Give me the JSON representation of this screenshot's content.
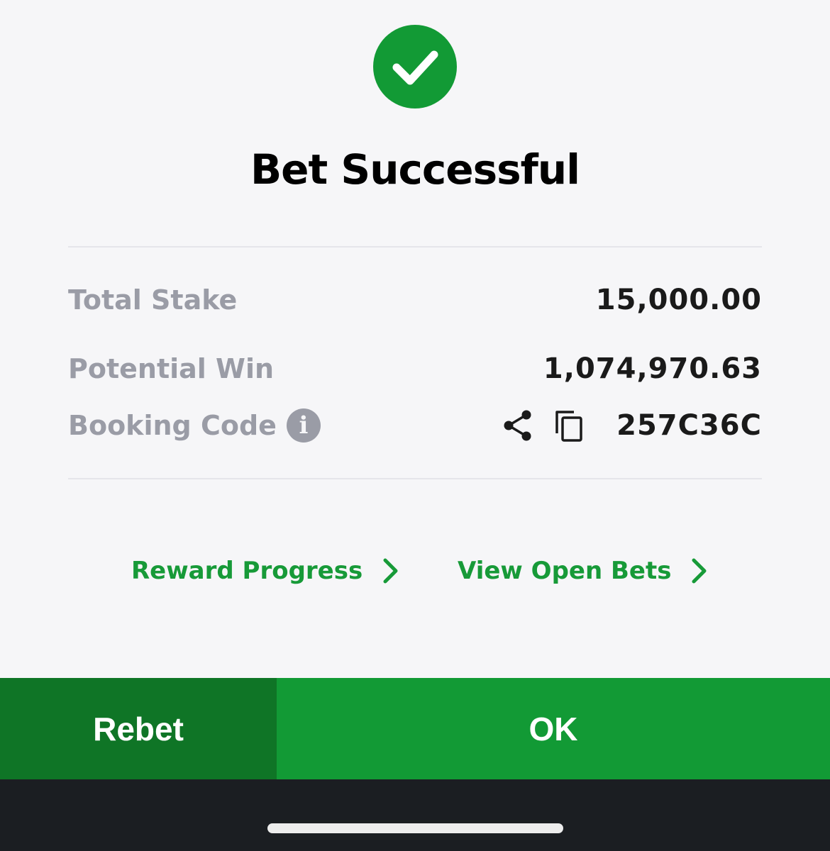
{
  "header": {
    "status_icon": "check-circle-icon",
    "title": "Bet Successful"
  },
  "details": {
    "total_stake": {
      "label": "Total Stake",
      "value": "15,000.00"
    },
    "potential_win": {
      "label": "Potential Win",
      "value": "1,074,970.63"
    },
    "booking_code": {
      "label": "Booking Code",
      "info_icon_text": "i",
      "value": "257C36C",
      "icons": [
        "share-icon",
        "copy-icon"
      ]
    }
  },
  "links": {
    "reward_progress": "Reward Progress",
    "view_open_bets": "View Open Bets"
  },
  "footer": {
    "rebet_label": "Rebet",
    "ok_label": "OK"
  },
  "colors": {
    "brand_green": "#129a35",
    "dark_green": "#0f7526",
    "label_gray": "#9a9ca6",
    "background": "#f6f6f8"
  }
}
